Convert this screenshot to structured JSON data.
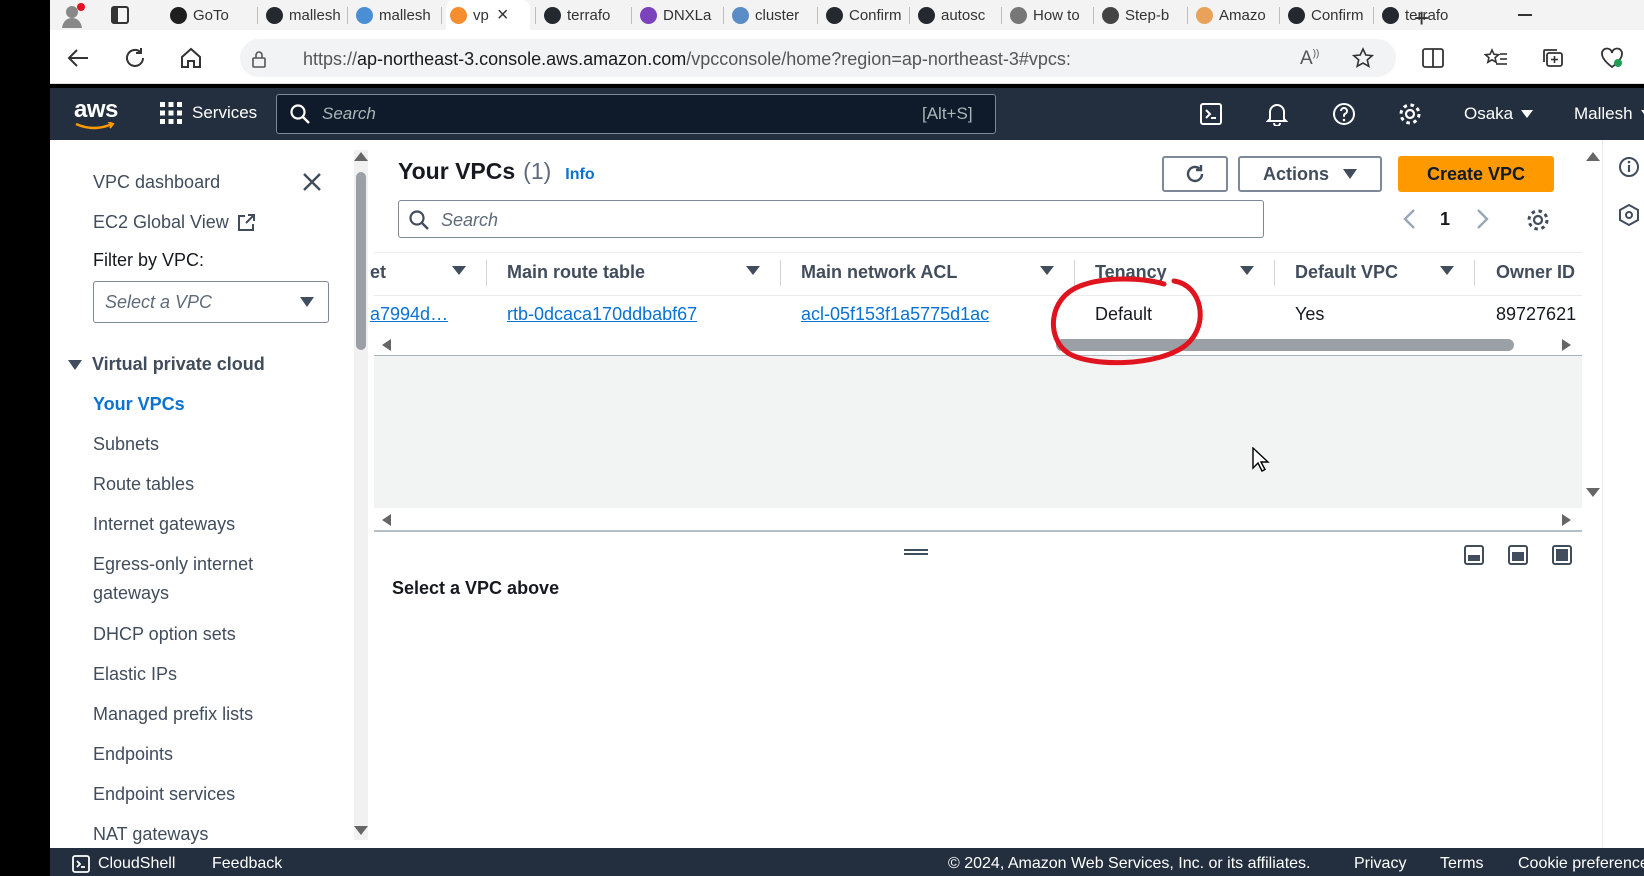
{
  "browser": {
    "tabs": [
      {
        "label": "GoTo",
        "color": "#1f1f1f"
      },
      {
        "label": "mallesh",
        "color": "#24292f"
      },
      {
        "label": "mallesh",
        "color": "#4a8fd6"
      },
      {
        "label": "vp",
        "color": "#f68d2e",
        "active": true
      },
      {
        "label": "terrafo",
        "color": "#24292f"
      },
      {
        "label": "DNXLa",
        "color": "#7b42bc"
      },
      {
        "label": "cluster",
        "color": "#5a8dc8"
      },
      {
        "label": "Confirm",
        "color": "#24292f"
      },
      {
        "label": "autosc",
        "color": "#24292f"
      },
      {
        "label": "How to",
        "color": "#777777"
      },
      {
        "label": "Step-b",
        "color": "#444444"
      },
      {
        "label": "Amazo",
        "color": "#e8a25a"
      },
      {
        "label": "Confirm",
        "color": "#24292f"
      },
      {
        "label": "terrafo",
        "color": "#24292f"
      }
    ],
    "url_prefix": "https://",
    "url_domain": "ap-northeast-3.console.aws.amazon.com",
    "url_path": "/vpcconsole/home?region=ap-northeast-3#vpcs:"
  },
  "aws_nav": {
    "logo": "aws",
    "services_label": "Services",
    "search_placeholder": "Search",
    "search_shortcut": "[Alt+S]",
    "region": "Osaka",
    "user": "Mallesh"
  },
  "sidebar": {
    "dashboard": "VPC dashboard",
    "ec2_global": "EC2 Global View",
    "filter_label": "Filter by VPC:",
    "filter_placeholder": "Select a VPC",
    "section_title": "Virtual private cloud",
    "items": [
      {
        "label": "Your VPCs",
        "active": true
      },
      {
        "label": "Subnets"
      },
      {
        "label": "Route tables"
      },
      {
        "label": "Internet gateways"
      },
      {
        "label": "Egress-only internet"
      },
      {
        "label": "gateways"
      },
      {
        "label": "DHCP option sets"
      },
      {
        "label": "Elastic IPs"
      },
      {
        "label": "Managed prefix lists"
      },
      {
        "label": "Endpoints"
      },
      {
        "label": "Endpoint services"
      },
      {
        "label": "NAT gateways"
      }
    ]
  },
  "main": {
    "title": "Your VPCs",
    "count": "(1)",
    "info": "Info",
    "actions_label": "Actions",
    "create_label": "Create VPC",
    "search_placeholder": "Search",
    "page": "1",
    "columns": [
      "et",
      "Main route table",
      "Main network ACL",
      "Tenancy",
      "Default VPC",
      "Owner ID"
    ],
    "row": {
      "partial": "a7994d…",
      "route_table": "rtb-0dcaca170ddbabf67",
      "network_acl": "acl-05f153f1a5775d1ac",
      "tenancy": "Default",
      "default_vpc": "Yes",
      "owner_id": "89727621"
    },
    "details_empty": "Select a VPC above"
  },
  "footer": {
    "cloudshell": "CloudShell",
    "feedback": "Feedback",
    "copyright": "© 2024, Amazon Web Services, Inc. or its affiliates.",
    "privacy": "Privacy",
    "terms": "Terms",
    "cookies": "Cookie preferences"
  },
  "colors": {
    "aws_nav": "#232f3e",
    "primary_button": "#ff9900",
    "link": "#0972d3",
    "annotation": "#e0141e"
  }
}
